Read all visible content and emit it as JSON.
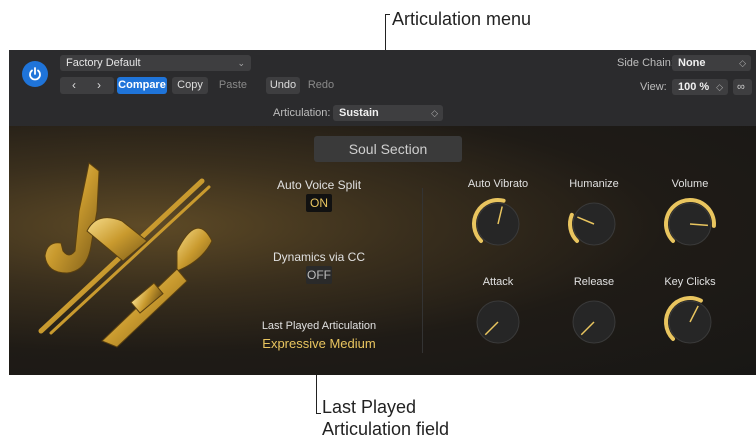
{
  "callouts": {
    "articulation_menu": "Articulation menu",
    "last_played_line1": "Last Played",
    "last_played_line2": "Articulation field"
  },
  "header": {
    "preset": "Factory Default",
    "compare": "Compare",
    "copy": "Copy",
    "paste": "Paste",
    "undo": "Undo",
    "redo": "Redo",
    "side_chain_label": "Side Chain:",
    "side_chain_value": "None",
    "view_label": "View:",
    "view_value": "100 %",
    "articulation_label": "Articulation:",
    "articulation_value": "Sustain"
  },
  "panel": {
    "title": "Soul Section",
    "auto_voice_split_label": "Auto Voice Split",
    "auto_voice_split_value": "ON",
    "dynamics_label": "Dynamics via CC",
    "dynamics_value": "OFF",
    "last_played_label": "Last Played Articulation",
    "last_played_value": "Expressive Medium"
  },
  "knobs": [
    {
      "label": "Auto Vibrato",
      "value": 0.55
    },
    {
      "label": "Humanize",
      "value": 0.25
    },
    {
      "label": "Volume",
      "value": 0.85
    },
    {
      "label": "Attack",
      "value": 0.0
    },
    {
      "label": "Release",
      "value": 0.0
    },
    {
      "label": "Key Clicks",
      "value": 0.6
    }
  ],
  "colors": {
    "accent": "#1f74d9",
    "gold": "#e9c55f",
    "header_bg": "#2b2b2d"
  }
}
